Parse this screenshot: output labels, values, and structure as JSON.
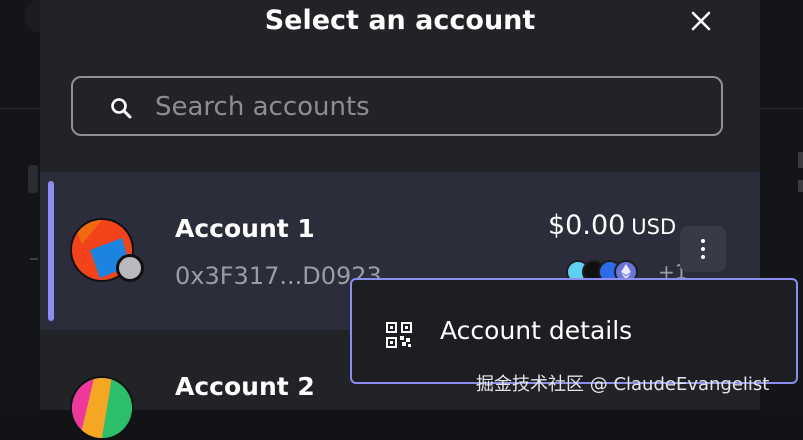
{
  "modal": {
    "title": "Select an account"
  },
  "search": {
    "placeholder": "Search accounts",
    "value": ""
  },
  "accounts": [
    {
      "name": "Account 1",
      "address": "0x3F317...D0923",
      "balance": "$0.00",
      "currency": "USD",
      "more_tokens": "+1",
      "selected": true
    },
    {
      "name": "Account 2"
    }
  ],
  "popover": {
    "item_label": "Account details"
  },
  "watermark": "掘金技术社区 @ ClaudeEvangelist",
  "colors": {
    "modal_bg": "#222327",
    "selected_row_bg": "#2b2e3a",
    "accent": "#8b8df0",
    "secondary_text": "#9b9da2"
  },
  "icons": {
    "close": "close-icon",
    "search": "search-icon",
    "more": "more-vertical-icon",
    "qr": "qr-code-icon"
  }
}
